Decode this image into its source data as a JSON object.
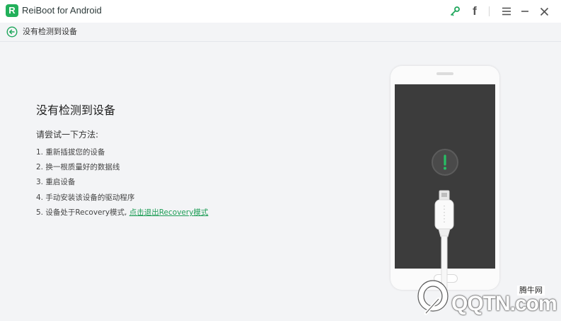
{
  "app": {
    "logo_letter": "R",
    "title": "ReiBoot for Android"
  },
  "titlebar": {
    "icons": [
      "key-icon",
      "facebook-icon",
      "menu-icon",
      "minimize-icon",
      "close-icon"
    ],
    "facebook_glyph": "f"
  },
  "breadcrumb": {
    "label": "没有检测到设备"
  },
  "main": {
    "heading": "没有检测到设备",
    "subheading": "请尝试一下方法:",
    "steps": [
      "1. 重新插拔您的设备",
      "2. 换一根质量好的数据线",
      "3. 重启设备",
      "4. 手动安装该设备的驱动程序"
    ],
    "step5_text": "5. 设备处于Recovery模式,",
    "step5_link": "点击退出Recovery模式"
  },
  "watermark": {
    "text": "QQTN.com",
    "cn": "腾牛网"
  },
  "colors": {
    "accent": "#22b05a",
    "link": "#1f9e57",
    "screen": "#3c3c3c",
    "background": "#f3f4f6"
  }
}
